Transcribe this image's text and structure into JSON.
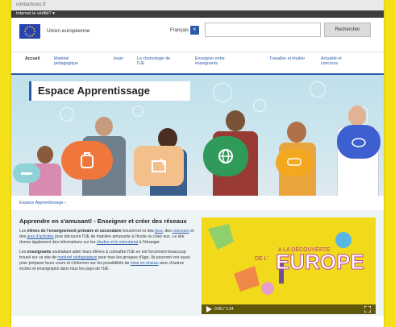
{
  "browser": {
    "url_text": "contactsucc.fr",
    "eu_notice": "Internet le vérifié? ▾"
  },
  "header": {
    "org_name": "Union européenne",
    "language_label": "Français",
    "language_code": "fr",
    "search_placeholder": "",
    "search_button": "Rechercher"
  },
  "nav": {
    "items": [
      {
        "label": "Accueil",
        "active": true
      },
      {
        "label": "Matériel pédagogique",
        "active": false
      },
      {
        "label": "Jouer",
        "active": false
      },
      {
        "label": "La chronologie de l'UE",
        "active": false
      },
      {
        "label": "Enseigner entre enseignants",
        "active": false
      },
      {
        "label": "Travailler et étudier",
        "active": false
      },
      {
        "label": "Actualité et concours",
        "active": false
      }
    ]
  },
  "hero": {
    "title": "Espace Apprentissage"
  },
  "breadcrumb": {
    "current": "Espace Apprentissage",
    "separator": "›"
  },
  "article": {
    "title": "Apprendre en s'amusant! - Enseigner et créer des réseaux",
    "p1_part1": "Les ",
    "p1_bold": "élèves de l'enseignement primaire et secondaire",
    "p1_part2": " trouveront ici des ",
    "p1_link1": "jeux",
    "p1_part3": ", des ",
    "p1_link2": "concours",
    "p1_part4": " et des ",
    "p1_link3": "jeux d'activités",
    "p1_part5": " pour découvrir l'UE de manière amusante à l'école ou chez eux. Le site donne également des informations sur les ",
    "p1_link4": "études et le volontariat",
    "p1_part6": " à l'étranger.",
    "p2_part1": "Les ",
    "p2_bold": "enseignants",
    "p2_part2": " souhaitant aider leurs élèves à connaître l'UE en ont forcément beaucoup trouvé sur ce site de ",
    "p2_link1": "matériel pédagogique",
    "p2_part3": " pour tous les groupes d'âge. Ils pourront voir aussi pour préparer leurs cours et s'informer sur les possibilités de ",
    "p2_link2": "mise en réseau",
    "p2_part4": " avec d'autres écoles et enseignants dans tous les pays de l'UE."
  },
  "video": {
    "title_line1": "A LA DÉCOUVERTE",
    "title_line2": "DE L'",
    "title_word": "EUROPE",
    "time": "0:00 / 1:24"
  },
  "colors": {
    "page_background": "#f5e11a",
    "accent_blue": "#2b5ca8",
    "eu_flag_blue": "#2743b3",
    "eu_flag_gold": "#ffcc00",
    "video_yellow": "#f1d91c"
  }
}
